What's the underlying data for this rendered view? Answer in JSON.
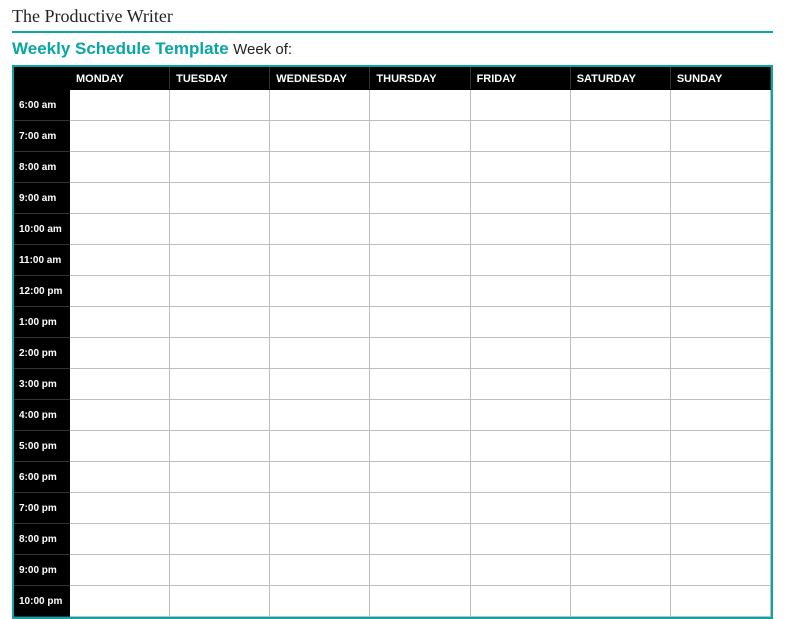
{
  "site_title": "The Productive Writer",
  "heading": {
    "main": "Weekly Schedule Template",
    "sub": "Week of:"
  },
  "days": [
    "MONDAY",
    "TUESDAY",
    "WEDNESDAY",
    "THURSDAY",
    "FRIDAY",
    "SATURDAY",
    "SUNDAY"
  ],
  "times": [
    "6:00 am",
    "7:00 am",
    "8:00 am",
    "9:00 am",
    "10:00 am",
    "11:00 am",
    "12:00 pm",
    "1:00 pm",
    "2:00 pm",
    "3:00 pm",
    "4:00 pm",
    "5:00 pm",
    "6:00 pm",
    "7:00 pm",
    "8:00 pm",
    "9:00 pm",
    "10:00 pm"
  ]
}
